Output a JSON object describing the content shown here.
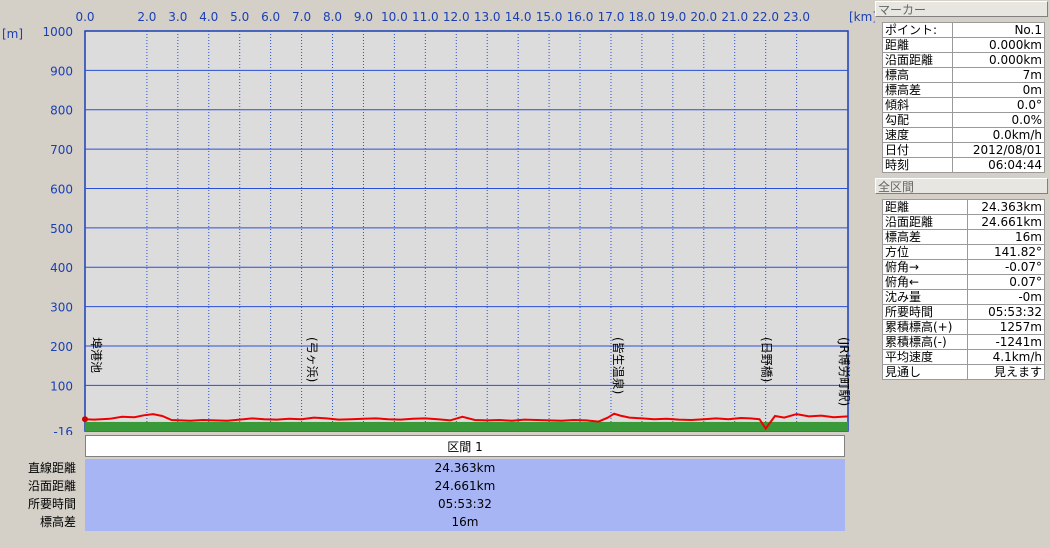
{
  "chart_data": {
    "type": "line",
    "x_unit": "[km]",
    "y_unit": "[m]",
    "x_ticks": [
      "0.0",
      "2.0",
      "3.0",
      "4.0",
      "5.0",
      "6.0",
      "7.0",
      "8.0",
      "9.0",
      "10.0",
      "11.0",
      "12.0",
      "13.0",
      "14.0",
      "15.0",
      "16.0",
      "17.0",
      "18.0",
      "19.0",
      "20.0",
      "21.0",
      "22.0",
      "23.0"
    ],
    "y_ticks": [
      "1000",
      "900",
      "800",
      "700",
      "600",
      "500",
      "400",
      "300",
      "200",
      "100",
      "-16"
    ],
    "xlim": [
      0,
      24.661
    ],
    "ylim": [
      -16,
      1000
    ],
    "landmarks": [
      {
        "name": "埠港池",
        "x": 0.0
      },
      {
        "name": "(弓ヶ浜)",
        "x": 7.2
      },
      {
        "name": "(皆生温泉)",
        "x": 17.1
      },
      {
        "name": "(日野橋)",
        "x": 21.9
      },
      {
        "name": "(JR博労町駅)",
        "x": 24.4
      }
    ],
    "series": [
      {
        "color": "#ee0000",
        "x": [
          0,
          0.3,
          0.8,
          1.2,
          1.6,
          1.9,
          2.2,
          2.5,
          2.8,
          3.1,
          3.4,
          3.8,
          4.2,
          4.6,
          5.0,
          5.4,
          5.8,
          6.2,
          6.6,
          7.0,
          7.4,
          7.8,
          8.2,
          8.6,
          9.0,
          9.4,
          9.8,
          10.2,
          10.6,
          11.0,
          11.4,
          11.8,
          12.2,
          12.6,
          13.0,
          13.4,
          13.8,
          14.2,
          14.6,
          15.0,
          15.4,
          15.8,
          16.2,
          16.6,
          16.9,
          17.1,
          17.3,
          17.6,
          18.0,
          18.4,
          18.8,
          19.2,
          19.6,
          20.0,
          20.4,
          20.8,
          21.2,
          21.5,
          21.8,
          22.0,
          22.3,
          22.6,
          23.0,
          23.4,
          23.8,
          24.2,
          24.661
        ],
        "y": [
          14,
          13,
          15,
          20,
          19,
          24,
          27,
          22,
          12,
          11,
          10,
          12,
          11,
          10,
          13,
          16,
          14,
          13,
          15,
          14,
          18,
          16,
          13,
          14,
          15,
          16,
          14,
          13,
          15,
          16,
          14,
          11,
          20,
          12,
          11,
          12,
          10,
          13,
          12,
          11,
          10,
          12,
          11,
          8,
          18,
          28,
          23,
          18,
          16,
          14,
          15,
          13,
          12,
          14,
          16,
          14,
          17,
          16,
          14,
          -10,
          22,
          18,
          27,
          21,
          23,
          19,
          21
        ]
      }
    ],
    "ground_level": 7
  },
  "section": {
    "title": "区間 1",
    "rows": [
      {
        "label": "直線距離",
        "value": "24.363km"
      },
      {
        "label": "沿面距離",
        "value": "24.661km"
      },
      {
        "label": "所要時間",
        "value": "05:53:32"
      },
      {
        "label": "標高差",
        "value": "16m"
      }
    ]
  },
  "marker_panel": {
    "title": "マーカー",
    "rows": [
      {
        "label": "ポイント:",
        "value": "No.1"
      },
      {
        "label": "距離",
        "value": "0.000km"
      },
      {
        "label": "沿面距離",
        "value": "0.000km"
      },
      {
        "label": "標高",
        "value": "7m"
      },
      {
        "label": "標高差",
        "value": "0m"
      },
      {
        "label": "傾斜",
        "value": "0.0°"
      },
      {
        "label": "勾配",
        "value": "0.0%"
      },
      {
        "label": "速度",
        "value": "0.0km/h"
      },
      {
        "label": "日付",
        "value": "2012/08/01"
      },
      {
        "label": "時刻",
        "value": "06:04:44"
      }
    ]
  },
  "total_panel": {
    "title": "全区間",
    "rows": [
      {
        "label": "距離",
        "value": "24.363km"
      },
      {
        "label": "沿面距離",
        "value": "24.661km"
      },
      {
        "label": "標高差",
        "value": "16m"
      },
      {
        "label": "方位",
        "value": "141.82°"
      },
      {
        "label": "俯角→",
        "value": "-0.07°"
      },
      {
        "label": "俯角←",
        "value": "0.07°"
      },
      {
        "label": "沈み量",
        "value": "-0m"
      },
      {
        "label": "所要時間",
        "value": "05:53:32"
      },
      {
        "label": "累積標高(+)",
        "value": "1257m"
      },
      {
        "label": "累積標高(-)",
        "value": "-1241m"
      },
      {
        "label": "平均速度",
        "value": "4.1km/h"
      },
      {
        "label": "見通し",
        "value": "見えます"
      }
    ]
  },
  "colors": {
    "axis_text": "#1a3fb5",
    "grid": "#2a4fd8",
    "plot_bg": "#dcdcdc",
    "profile": "#ee0000",
    "ground": "#3a9a3a",
    "section_bg": "#a8b5f5"
  }
}
